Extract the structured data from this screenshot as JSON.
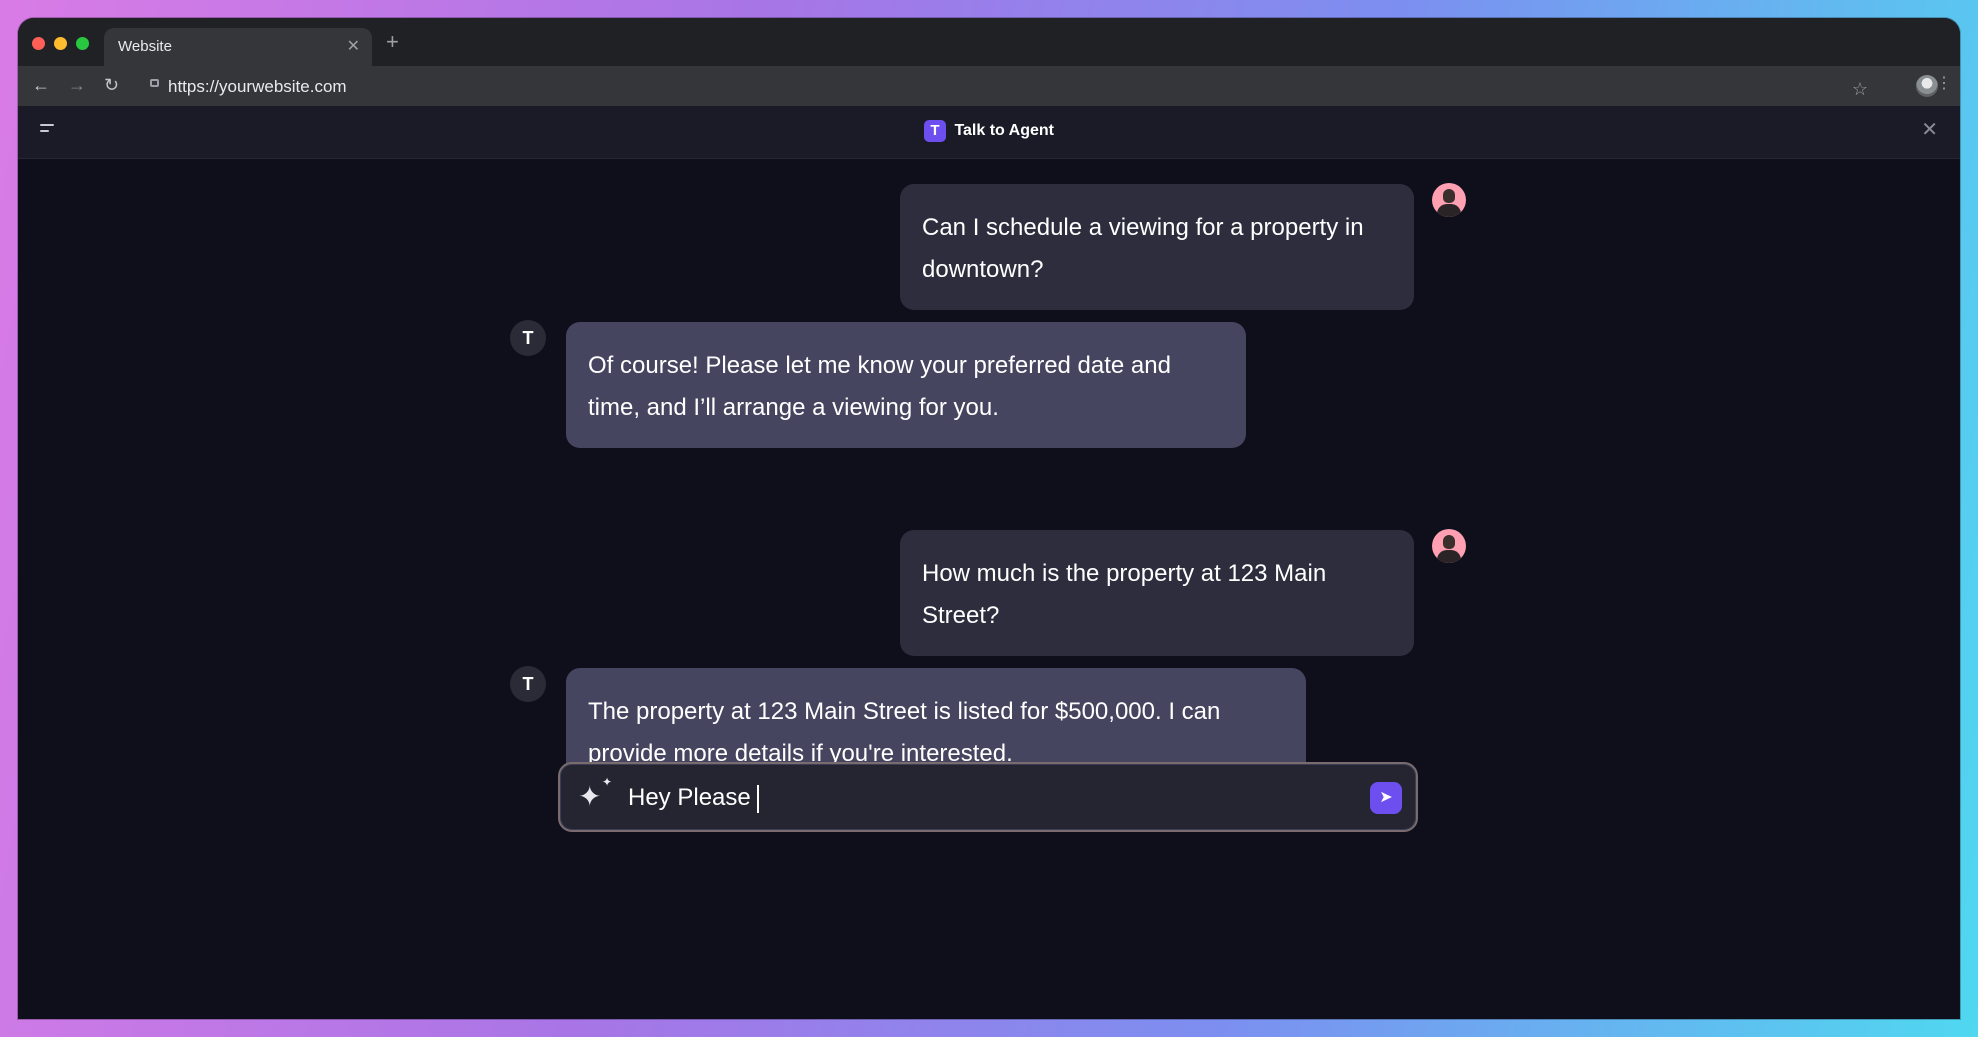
{
  "browser": {
    "tab_title": "Website",
    "url": "https://yourwebsite.com"
  },
  "app": {
    "title": "Talk to Agent",
    "logo_letter": "T"
  },
  "messages": [
    {
      "role": "user",
      "text": "Can I schedule a viewing for a property in downtown?"
    },
    {
      "role": "agent",
      "text": "Of course! Please let me know your preferred date and time, and I’ll arrange a viewing for you."
    },
    {
      "role": "user",
      "text": "How much is the property at 123 Main Street?"
    },
    {
      "role": "agent",
      "text": "The property at 123 Main Street is listed for $500,000. I can provide more details if you're interested."
    }
  ],
  "composer": {
    "value": "Hey Please"
  },
  "colors": {
    "accent": "#6d4ff0",
    "user_bubble": "#2d2d3d",
    "agent_bubble": "#454560",
    "background": "#0f0f1c"
  },
  "icons": [
    "menu-icon",
    "close-icon",
    "avatar",
    "agent-logo-icon",
    "sparkle-icon",
    "send-icon",
    "back-icon",
    "forward-icon",
    "reload-icon",
    "star-icon",
    "lock-icon"
  ]
}
